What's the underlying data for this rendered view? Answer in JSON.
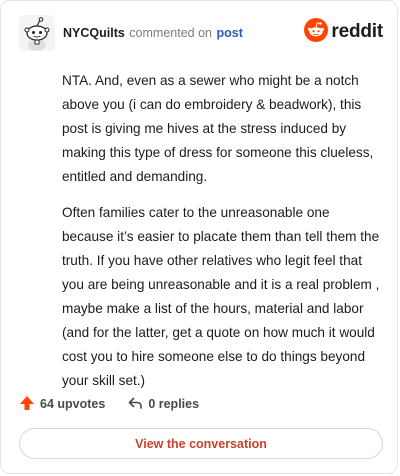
{
  "header": {
    "username": "NYCQuilts",
    "verb": "commented on",
    "post_link": "post",
    "brand": "reddit"
  },
  "comment": {
    "paragraphs": [
      "NTA. And, even as a sewer who might be a notch above you (i can do embroidery & beadwork), this post is giving me hives at the stress induced by making this type of dress for someone this clueless, entitled and demanding.",
      "Often families cater to the unreasonable one because it’s easier to placate them than tell them the truth. If you have other relatives who legit feel that you are being unreasonable and it is a real problem , maybe make a list of the hours, material and labor (and for the latter, get a quote on how much it would cost you to hire someone else to do things beyond your skill set.)"
    ]
  },
  "stats": {
    "upvotes": "64 upvotes",
    "replies": "0 replies"
  },
  "cta": {
    "label": "View the conversation"
  },
  "colors": {
    "accent": "#ff4500",
    "link": "#2a5db0",
    "cta_text": "#c9422b"
  },
  "icons": {
    "avatar": "snoo-avatar-icon",
    "brand": "reddit-logo-icon",
    "upvote": "upvote-arrow-icon",
    "reply": "reply-arrow-icon"
  }
}
